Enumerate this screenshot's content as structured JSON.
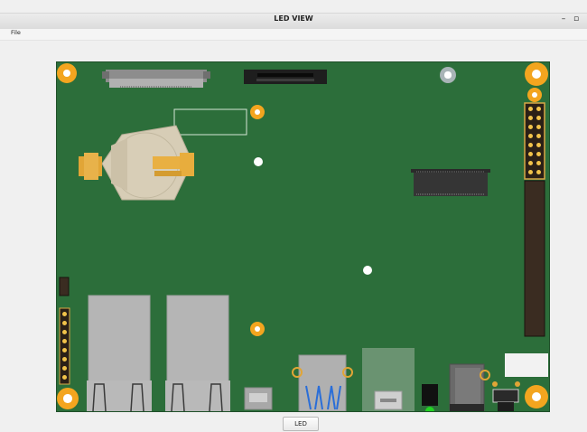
{
  "window": {
    "title": "LED VIEW",
    "minimize_glyph": "–",
    "restore_glyph": "▫"
  },
  "menu": {
    "file_label": "File"
  },
  "board": {
    "background_color": "#2c6e3a",
    "mount_hole_color": "#f3a51f",
    "led_color": "#23d423"
  },
  "controls": {
    "led_button_label": "LED"
  }
}
